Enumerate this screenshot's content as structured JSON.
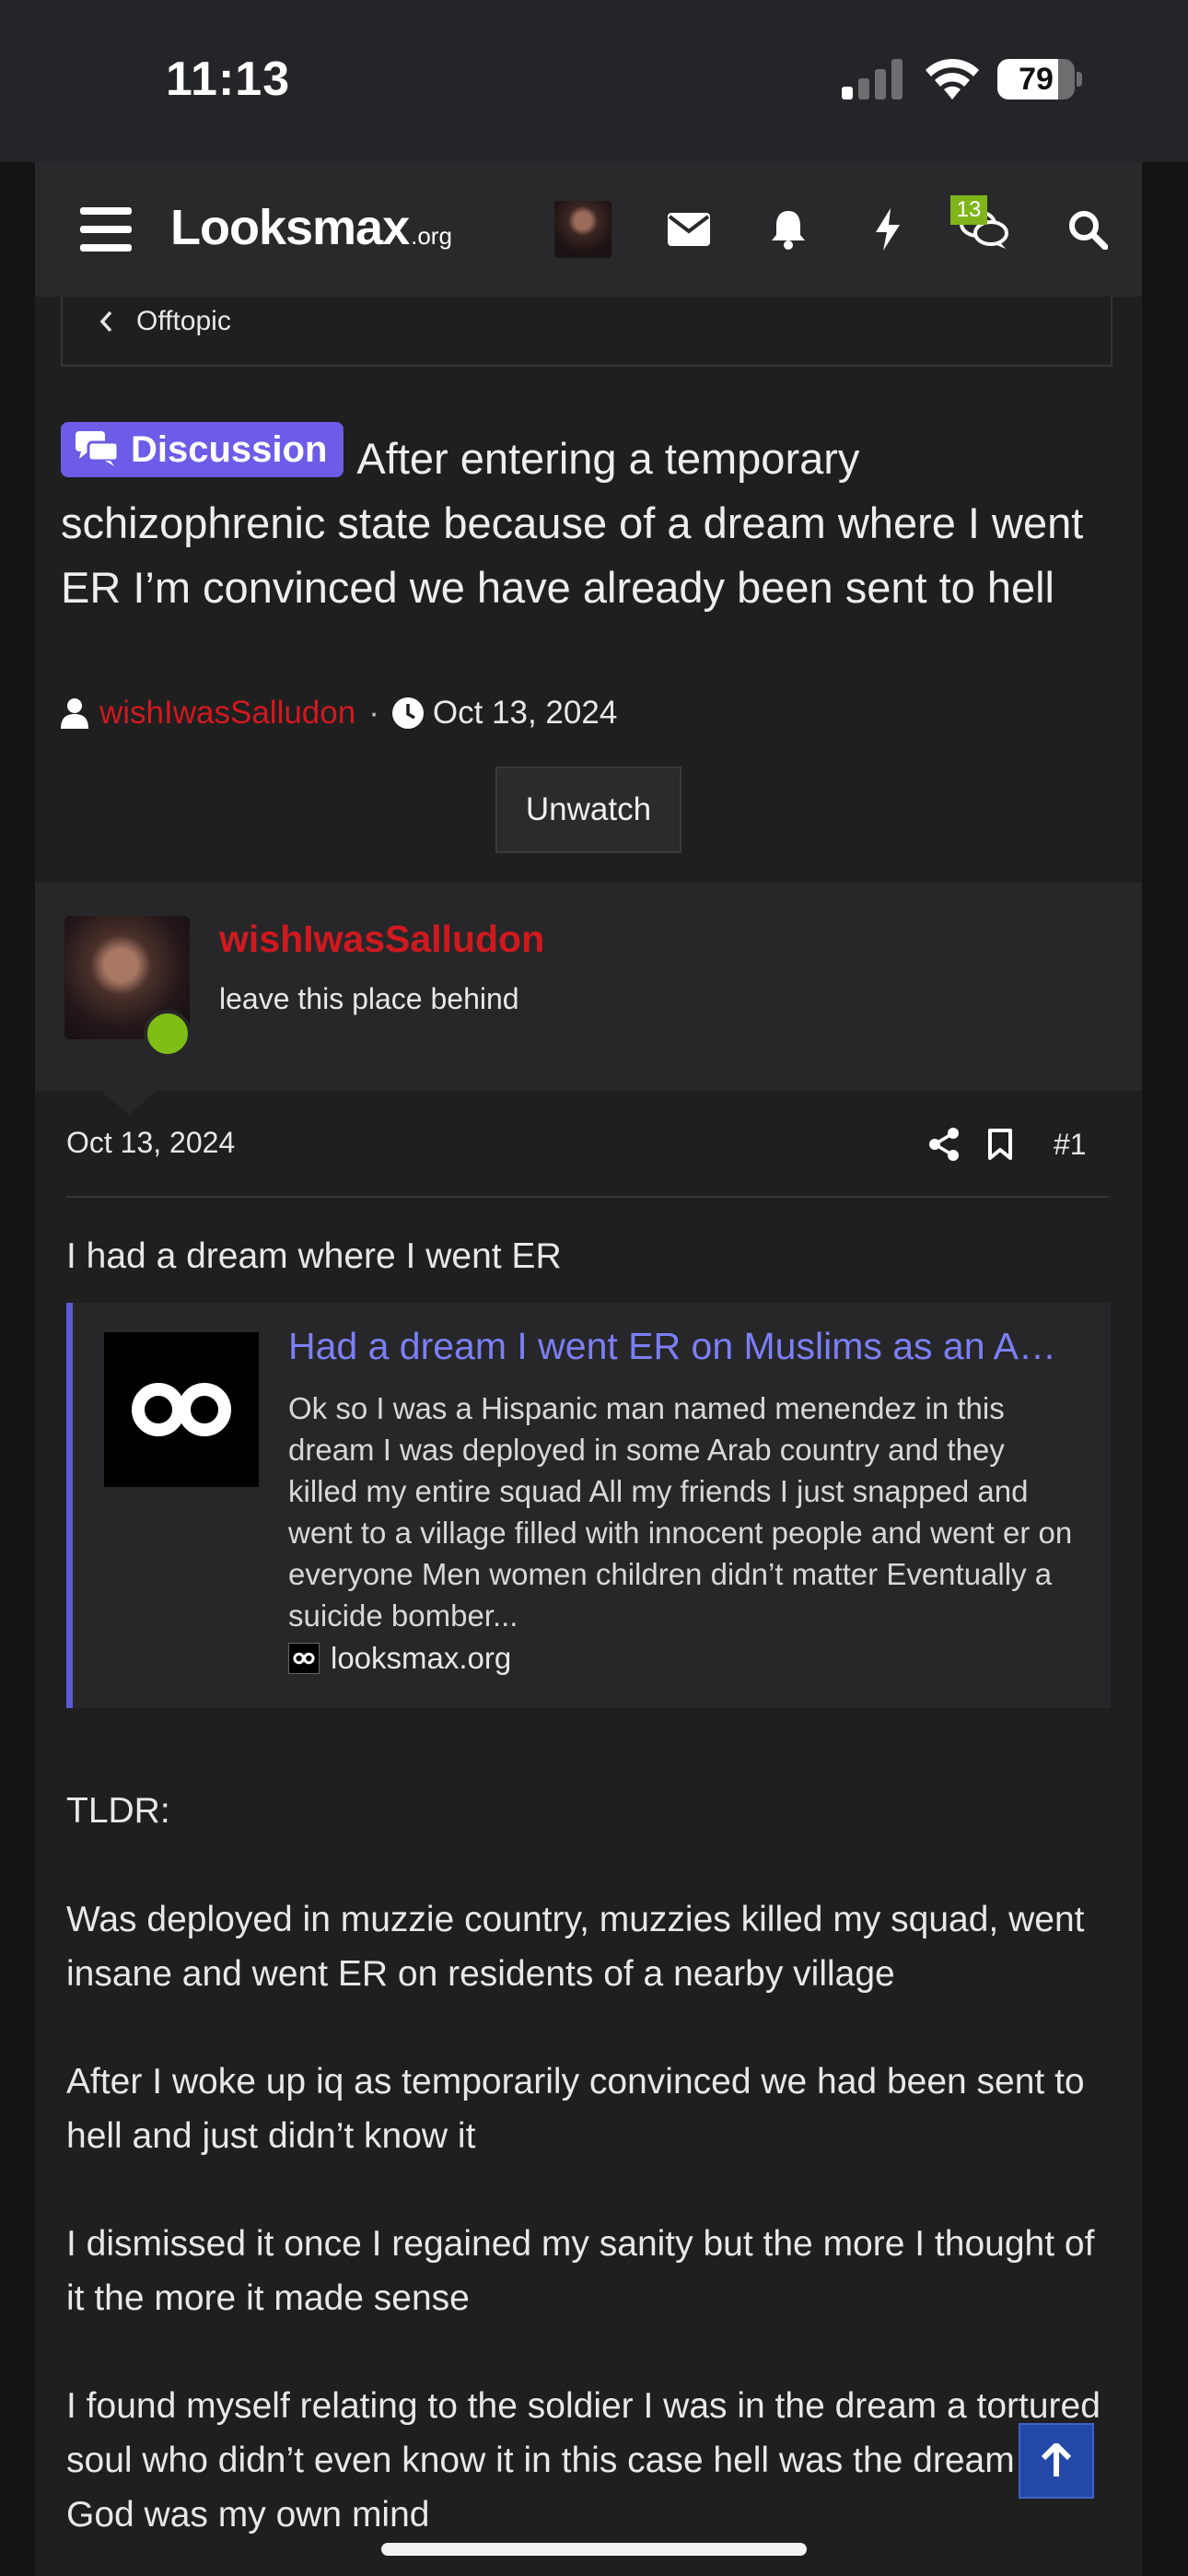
{
  "status_bar": {
    "time": "11:13",
    "battery": "79",
    "battery_level": 0.79
  },
  "nav": {
    "logo_main": "Looksmax",
    "logo_tld": ".org",
    "conversations_badge": "13"
  },
  "breadcrumb": {
    "label": "Offtopic"
  },
  "thread": {
    "label": "Discussion",
    "title": "After entering a temporary schizophrenic state because of a dream where I went ER I’m convinced we have already been sent to hell",
    "author": "wishIwasSalludon",
    "separator": "·",
    "date": "Oct 13, 2024",
    "unwatch_label": "Unwatch"
  },
  "post": {
    "username": "wishIwasSalludon",
    "user_title": "leave this place behind",
    "date": "Oct 13, 2024",
    "number": "#1",
    "intro": "I had a dream where I went ER",
    "unfurl": {
      "title": "Had a dream I went ER on Muslims as an American soldier",
      "description": "Ok so I was a Hispanic man named menendez in this dream I was deployed in some Arab country and they killed my entire squad All my friends I just snapped and went to a village filled with innocent people and went er on everyone Men women children didn’t matter Eventually a suicide bomber...",
      "domain": "looksmax.org"
    },
    "paragraphs": [
      "TLDR:",
      "Was deployed in muzzie country, muzzies killed my squad, went insane and went ER on residents of a nearby village",
      "After I woke up iq as temporarily convinced we had been sent to hell and just didn’t know it",
      "I dismissed it once I regained my sanity but the more I thought of it the more it made sense",
      "I found myself relating to the soldier I was in the dream a tortured soul who didn’t even know it in this case hell was the dream and God was my own mind"
    ]
  },
  "colors": {
    "accent_purple": "#6c5ce7",
    "author_red": "#d0191f",
    "link_blue": "#7c7ff5",
    "online_green": "#7fbe14"
  }
}
